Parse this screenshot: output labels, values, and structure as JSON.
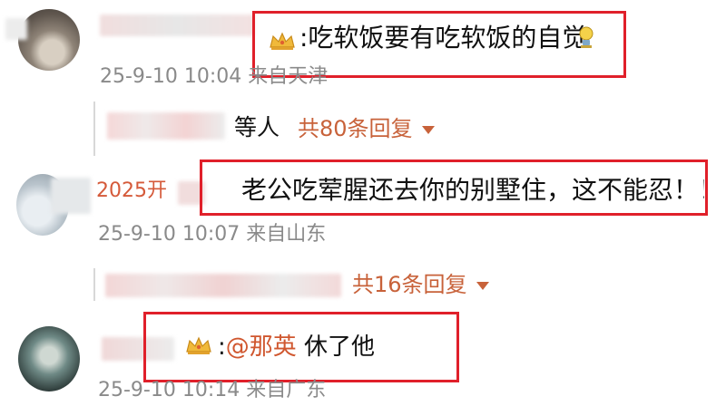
{
  "comments": [
    {
      "text": ":吃软饭要有吃软饭的自觉",
      "meta": "25-9-10 10:04 来自天津",
      "reply_prefix": "等人",
      "reply_count": "共80条回复"
    },
    {
      "username_partial": "2025开",
      "text": "老公吃荤腥还去你的别墅住，这不能忍！！！！",
      "meta": "25-9-10 10:07 来自山东",
      "reply_count": "共16条回复"
    },
    {
      "text_prefix": ":",
      "mention": "@那英",
      "text_suffix": " 休了他",
      "meta": "25-9-10 10:14 来自广东"
    }
  ],
  "colors": {
    "highlight_box": "#e0202a",
    "reply_link": "#c8623a",
    "meta_text": "#8a8a8a"
  }
}
